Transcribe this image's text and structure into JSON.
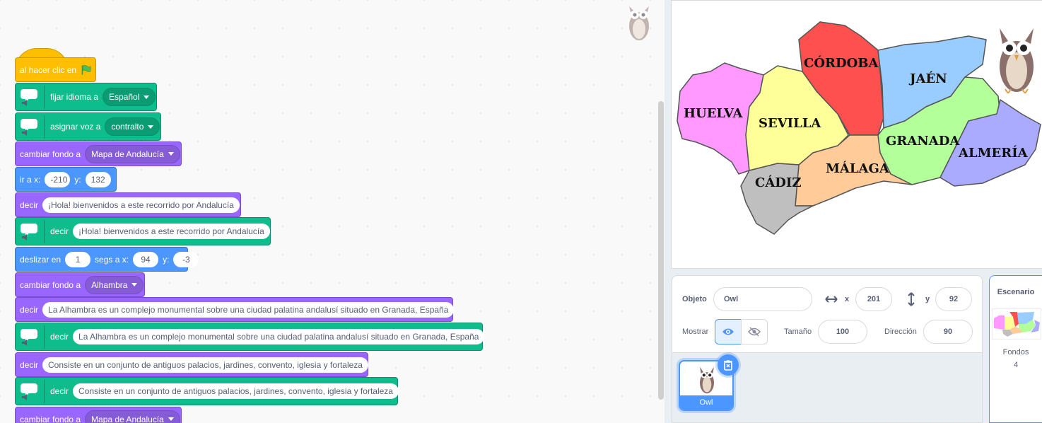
{
  "blocks": {
    "hat": {
      "label": "al hacer clic en"
    },
    "set_language": {
      "label": "fijar idioma a",
      "value": "Español"
    },
    "set_voice": {
      "label": "asignar voz a",
      "value": "contralto"
    },
    "switch_backdrop_1": {
      "label": "cambiar fondo a",
      "value": "Mapa de Andalucía"
    },
    "goto": {
      "label": "ir a x:",
      "x": "-210",
      "y_label": "y:",
      "y": "132"
    },
    "say_1": {
      "label": "decir",
      "text": "¡Hola! bienvenidos a este recorrido por Andalucía"
    },
    "speak_1": {
      "label": "decir",
      "text": "¡Hola! bienvenidos a este recorrido por Andalucía"
    },
    "glide": {
      "label": "deslizar en",
      "secs": "1",
      "secs_label": "segs a x:",
      "x": "94",
      "y_label": "y:",
      "y": "-3"
    },
    "switch_backdrop_2": {
      "label": "cambiar fondo a",
      "value": "Alhambra"
    },
    "say_2": {
      "label": "decir",
      "text": "La Alhambra es un complejo monumental sobre una ciudad palatina andalusí situado en Granada, España"
    },
    "speak_2": {
      "label": "decir",
      "text": "La Alhambra es un complejo monumental sobre una ciudad palatina andalusí situado en Granada, España"
    },
    "say_3": {
      "label": "decir",
      "text": "Consiste en un conjunto de antiguos palacios, jardines, convento, iglesia y fortaleza"
    },
    "speak_3": {
      "label": "decir",
      "text": "Consiste en un conjunto de antiguos palacios, jardines, convento, iglesia y fortaleza"
    },
    "switch_backdrop_3": {
      "label": "cambiar fondo a",
      "value": "Mapa de Andalucía"
    }
  },
  "map": {
    "provinces": [
      "HUELVA",
      "SEVILLA",
      "CÓRDOBA",
      "JAÉN",
      "GRANADA",
      "ALMERÍA",
      "MÁLAGA",
      "CÁDIZ"
    ]
  },
  "sprite_info": {
    "object_label": "Objeto",
    "object_name": "Owl",
    "x_label": "x",
    "x_value": "201",
    "y_label": "y",
    "y_value": "92",
    "show_label": "Mostrar",
    "size_label": "Tamaño",
    "size_value": "100",
    "direction_label": "Dirección",
    "direction_value": "90"
  },
  "sprites": [
    {
      "name": "Owl"
    }
  ],
  "stage_panel": {
    "title": "Escenario",
    "backdrops_label": "Fondos",
    "backdrops_count": "4"
  },
  "colors": {
    "events": "#ffbf00",
    "extension": "#0fbd8c",
    "looks": "#9966ff",
    "motion": "#4c97ff",
    "huelva": "#ff99ff",
    "sevilla": "#ffff99",
    "cordoba": "#ff5050",
    "jaen": "#99ccff",
    "granada": "#b3ff99",
    "almeria": "#aaaaff",
    "malaga": "#ffcc99",
    "cadiz": "#bfbfbf"
  }
}
